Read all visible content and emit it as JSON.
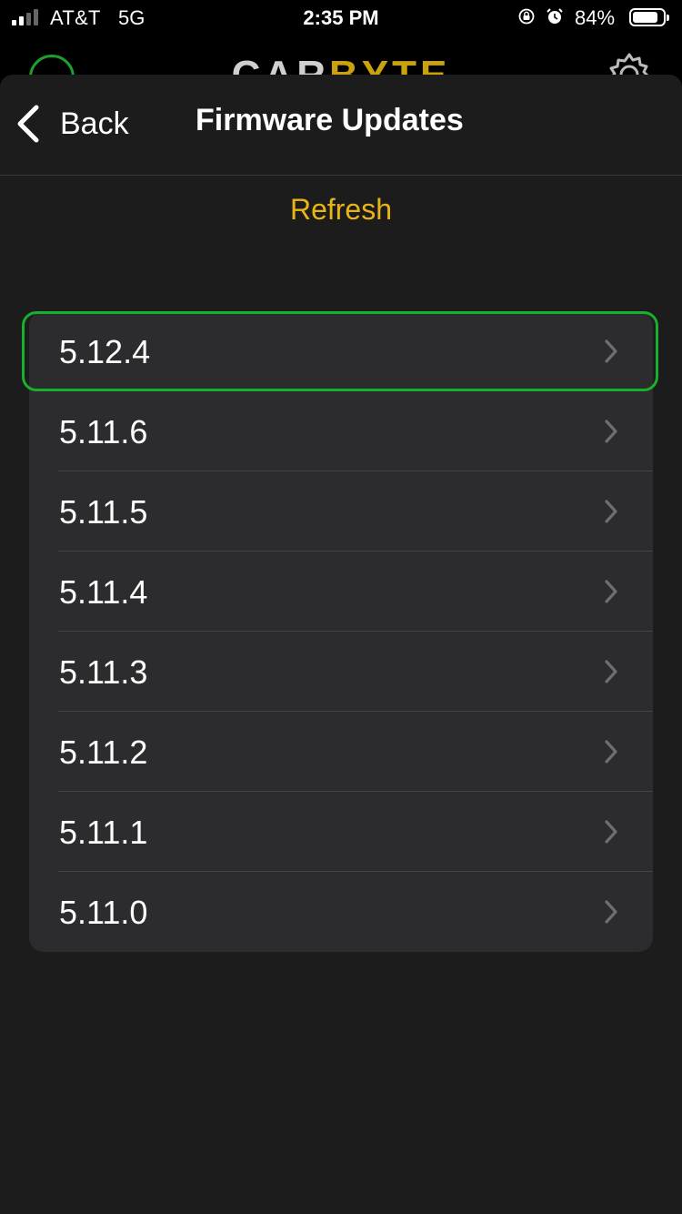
{
  "status_bar": {
    "carrier": "AT&T",
    "network": "5G",
    "time": "2:35 PM",
    "battery_percent": "84%",
    "battery_level": 0.84
  },
  "behind_header": {
    "brand_part1": "CAR",
    "brand_part2": "BYTE"
  },
  "nav": {
    "back_label": "Back",
    "title": "Firmware Updates"
  },
  "refresh_label": "Refresh",
  "colors": {
    "accent": "#e9b516",
    "selection": "#17b12e",
    "sheet_bg": "#1c1c1c",
    "row_bg": "#2c2c2e"
  },
  "versions": [
    {
      "label": "5.12.4",
      "selected": true
    },
    {
      "label": "5.11.6",
      "selected": false
    },
    {
      "label": "5.11.5",
      "selected": false
    },
    {
      "label": "5.11.4",
      "selected": false
    },
    {
      "label": "5.11.3",
      "selected": false
    },
    {
      "label": "5.11.2",
      "selected": false
    },
    {
      "label": "5.11.1",
      "selected": false
    },
    {
      "label": "5.11.0",
      "selected": false
    }
  ]
}
